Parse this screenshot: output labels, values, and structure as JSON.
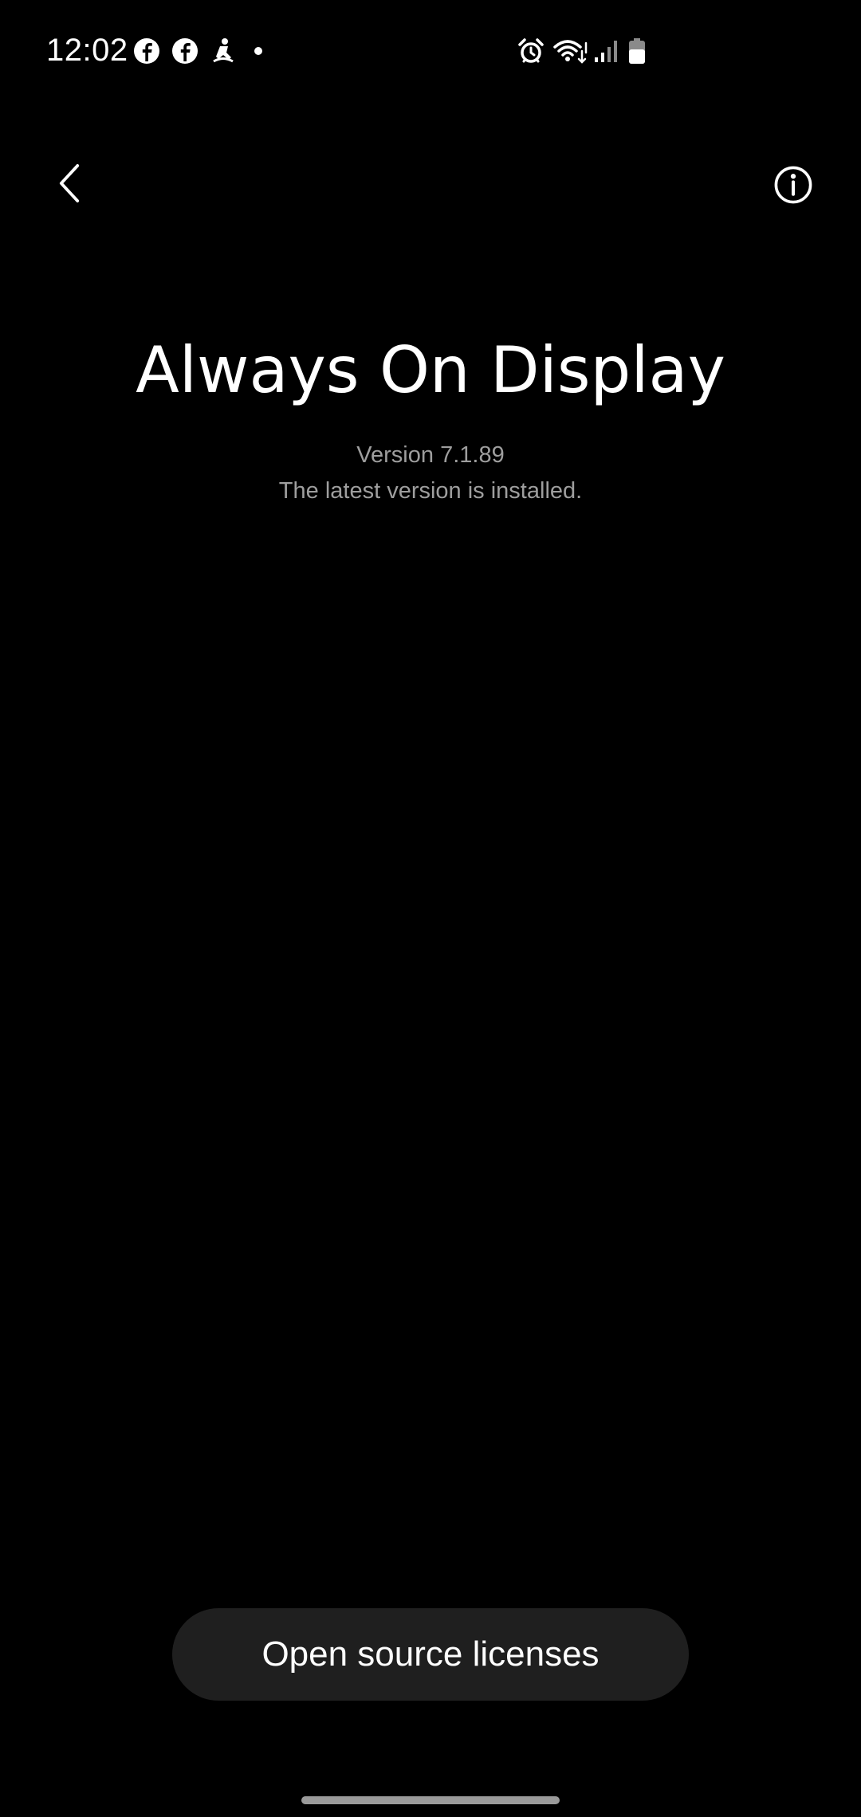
{
  "status_bar": {
    "time": "12:02",
    "notification_icons": [
      "facebook-icon",
      "facebook-icon",
      "accessibility-icon",
      "dot-icon"
    ],
    "system_icons": [
      "alarm-icon",
      "wifi-icon",
      "signal-icon",
      "battery-icon"
    ]
  },
  "app_bar": {
    "back_icon": "chevron-left-icon",
    "info_icon": "info-icon"
  },
  "about": {
    "title": "Always On Display",
    "version": "Version 7.1.89",
    "update_status": "The latest version is installed."
  },
  "footer": {
    "licenses_button_label": "Open source licenses"
  },
  "colors": {
    "background": "#000000",
    "text_primary": "#ffffff",
    "text_secondary": "#9e9e9e",
    "button_background": "#1f1f1f"
  }
}
